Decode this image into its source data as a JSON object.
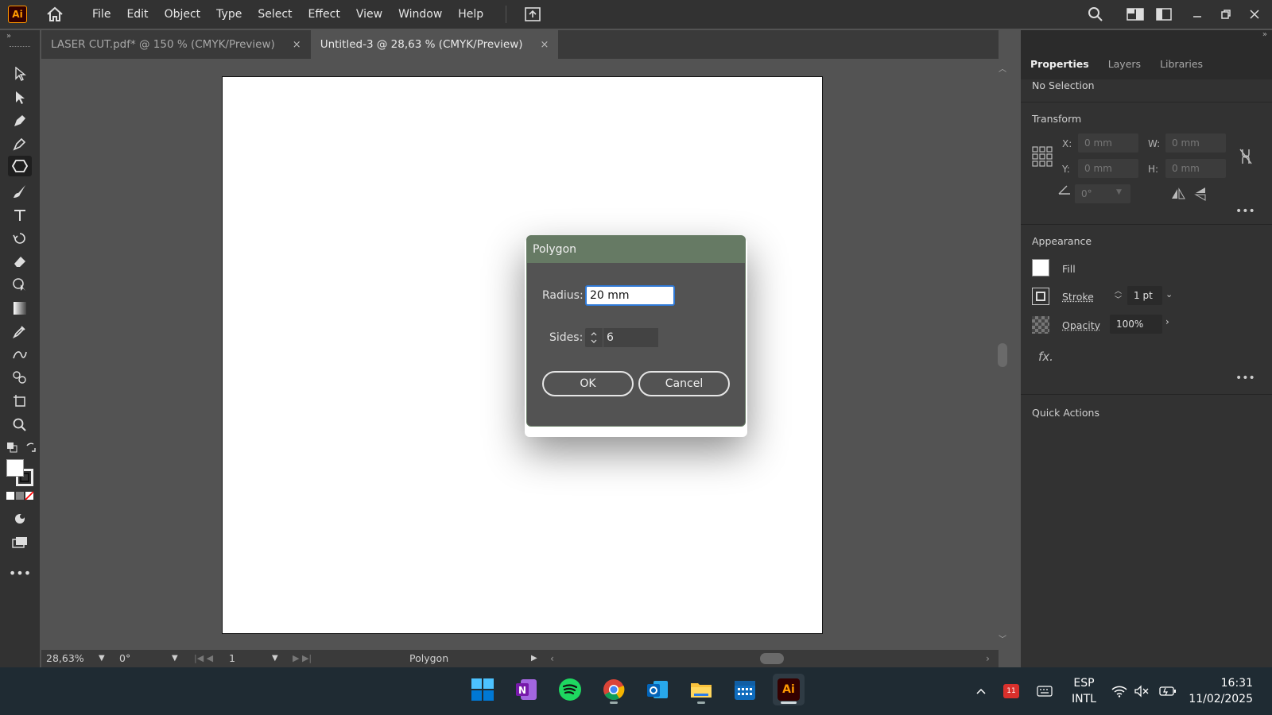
{
  "app": {
    "logo_text": "Ai"
  },
  "menu": [
    "File",
    "Edit",
    "Object",
    "Type",
    "Select",
    "Effect",
    "View",
    "Window",
    "Help"
  ],
  "tabs": [
    {
      "label": "LASER CUT.pdf* @ 150 % (CMYK/Preview)",
      "close": "×"
    },
    {
      "label": "Untitled-3 @ 28,63 % (CMYK/Preview)",
      "close": "×"
    }
  ],
  "panel": {
    "tabs": [
      "Properties",
      "Layers",
      "Libraries"
    ],
    "selection": "No Selection",
    "transform": {
      "title": "Transform",
      "x_label": "X:",
      "x_value": "0 mm",
      "y_label": "Y:",
      "y_value": "0 mm",
      "w_label": "W:",
      "w_value": "0 mm",
      "h_label": "H:",
      "h_value": "0 mm",
      "angle_value": "0°"
    },
    "appearance": {
      "title": "Appearance",
      "fill_label": "Fill",
      "stroke_label": "Stroke",
      "stroke_value": "1 pt",
      "opacity_label": "Opacity",
      "opacity_value": "100%",
      "fx_label": "fx."
    },
    "quick_actions": "Quick Actions"
  },
  "status": {
    "zoom": "28,63%",
    "rotation": "0°",
    "artboard": "1",
    "tool": "Polygon"
  },
  "dialog": {
    "title": "Polygon",
    "radius_label": "Radius:",
    "radius_value": "20 mm",
    "sides_label": "Sides:",
    "sides_value": "6",
    "ok": "OK",
    "cancel": "Cancel"
  },
  "taskbar": {
    "lang_top": "ESP",
    "lang_bottom": "INTL",
    "time": "16:31",
    "date": "11/02/2025",
    "badge": "11",
    "ai_label": "Ai"
  },
  "colors": {
    "accent": "#2f79d6",
    "dialog_title": "#667a64",
    "ai_orange": "#ff9a00"
  }
}
